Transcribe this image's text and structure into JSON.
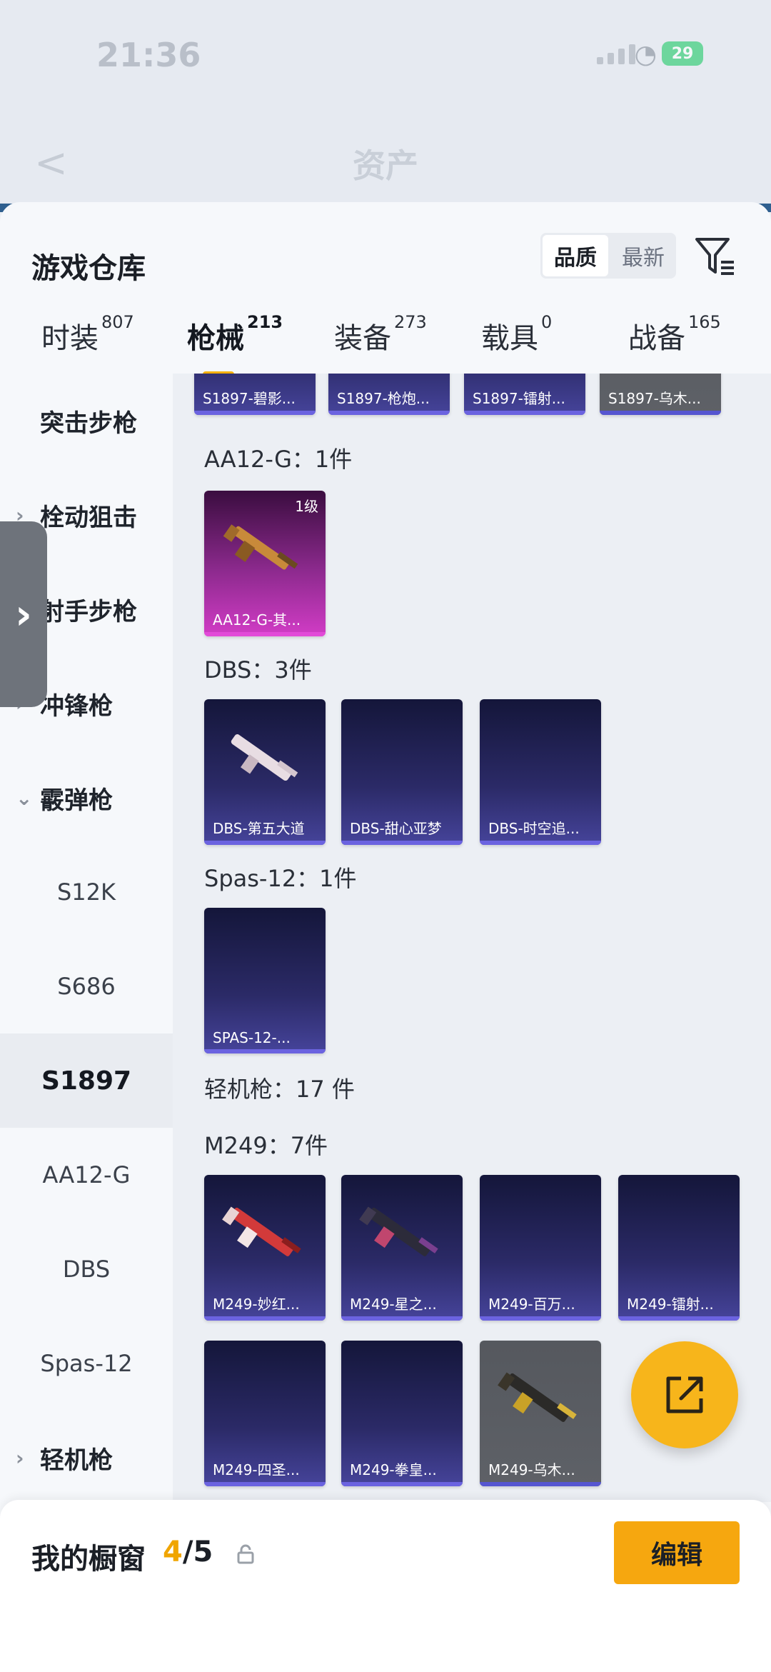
{
  "status": {
    "time": "21:36",
    "battery": "29"
  },
  "nav": {
    "title": "资产"
  },
  "sheet": {
    "title": "游戏仓库",
    "sort_options": [
      "品质",
      "最新"
    ],
    "tabs": [
      {
        "label": "时装",
        "count": "807"
      },
      {
        "label": "枪械",
        "count": "213"
      },
      {
        "label": "装备",
        "count": "273"
      },
      {
        "label": "载具",
        "count": "0"
      },
      {
        "label": "战备",
        "count": "165"
      }
    ]
  },
  "sidebar": {
    "items": [
      {
        "label": "突击步枪"
      },
      {
        "label": "栓动狙击"
      },
      {
        "label": "射手步枪"
      },
      {
        "label": "冲锋枪"
      },
      {
        "label": "霰弹枪"
      },
      {
        "label": "S12K"
      },
      {
        "label": "S686"
      },
      {
        "label": "S1897"
      },
      {
        "label": "AA12-G"
      },
      {
        "label": "DBS"
      },
      {
        "label": "Spas-12"
      },
      {
        "label": "轻机枪"
      }
    ]
  },
  "content": {
    "top_strip": [
      "S1897-碧影...",
      "S1897-枪炮...",
      "S1897-镭射...",
      "S1897-乌木..."
    ],
    "sections": {
      "aa12": {
        "label": "AA12-G：1件",
        "items": [
          {
            "name": "AA12-G-其...",
            "level": "1级"
          }
        ]
      },
      "dbs": {
        "label": "DBS：3件",
        "items": [
          {
            "name": "DBS-第五大道"
          },
          {
            "name": "DBS-甜心亚梦"
          },
          {
            "name": "DBS-时空追..."
          }
        ]
      },
      "spas": {
        "label": "Spas-12：1件",
        "items": [
          {
            "name": "SPAS-12-..."
          }
        ]
      },
      "lmg": {
        "label": "轻机枪：17 件"
      },
      "m249": {
        "label": "M249：7件",
        "items": [
          {
            "name": "M249-妙红..."
          },
          {
            "name": "M249-星之..."
          },
          {
            "name": "M249-百万..."
          },
          {
            "name": "M249-镭射..."
          },
          {
            "name": "M249-四圣..."
          },
          {
            "name": "M249-拳皇..."
          },
          {
            "name": "M249-乌木..."
          }
        ]
      }
    }
  },
  "bottom": {
    "label": "我的橱窗",
    "count_current": "4",
    "count_total": "/5",
    "edit_label": "编辑"
  },
  "colors": {
    "accent": "#F6A70F",
    "card_purple": "#2B2A67",
    "card_pink": "#D23CC6"
  }
}
